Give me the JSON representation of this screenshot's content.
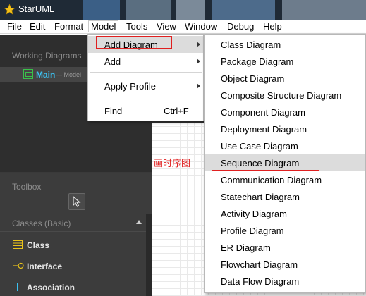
{
  "window": {
    "title": "StarUML"
  },
  "menubar": [
    {
      "key": "file",
      "label": "File"
    },
    {
      "key": "edit",
      "label": "Edit"
    },
    {
      "key": "format",
      "label": "Format"
    },
    {
      "key": "model",
      "label": "Model"
    },
    {
      "key": "tools",
      "label": "Tools"
    },
    {
      "key": "view",
      "label": "View"
    },
    {
      "key": "window",
      "label": "Window"
    },
    {
      "key": "debug",
      "label": "Debug"
    },
    {
      "key": "help",
      "label": "Help"
    }
  ],
  "sidebar": {
    "working_diagrams_title": "Working Diagrams",
    "main_item": {
      "name": "Main",
      "sub": "— Model"
    },
    "toolbox_title": "Toolbox",
    "classes_section": "Classes (Basic)",
    "tools": [
      {
        "label": "Class",
        "icon": "class-icon"
      },
      {
        "label": "Interface",
        "icon": "interface-icon"
      },
      {
        "label": "Association",
        "icon": "association-icon"
      }
    ]
  },
  "canvas": {
    "annotation": "画时序图"
  },
  "model_menu": {
    "items": [
      {
        "label": "Add Diagram",
        "submenu": true,
        "highlighted": true
      },
      {
        "label": "Add",
        "submenu": true
      },
      {
        "label": "Apply Profile",
        "submenu": true
      },
      {
        "label": "Find",
        "shortcut": "Ctrl+F"
      }
    ]
  },
  "diagram_menu": {
    "items": [
      "Class Diagram",
      "Package Diagram",
      "Object Diagram",
      "Composite Structure Diagram",
      "Component Diagram",
      "Deployment Diagram",
      "Use Case Diagram",
      "Sequence Diagram",
      "Communication Diagram",
      "Statechart Diagram",
      "Activity Diagram",
      "Profile Diagram",
      "ER Diagram",
      "Flowchart Diagram",
      "Data Flow Diagram"
    ],
    "highlighted": "Sequence Diagram"
  },
  "colors": {
    "annotation": "#e02020",
    "highlight": "#dcdcdc",
    "main_item": "#3cc1f0",
    "sidebar_bg": "#3a3a3a"
  }
}
